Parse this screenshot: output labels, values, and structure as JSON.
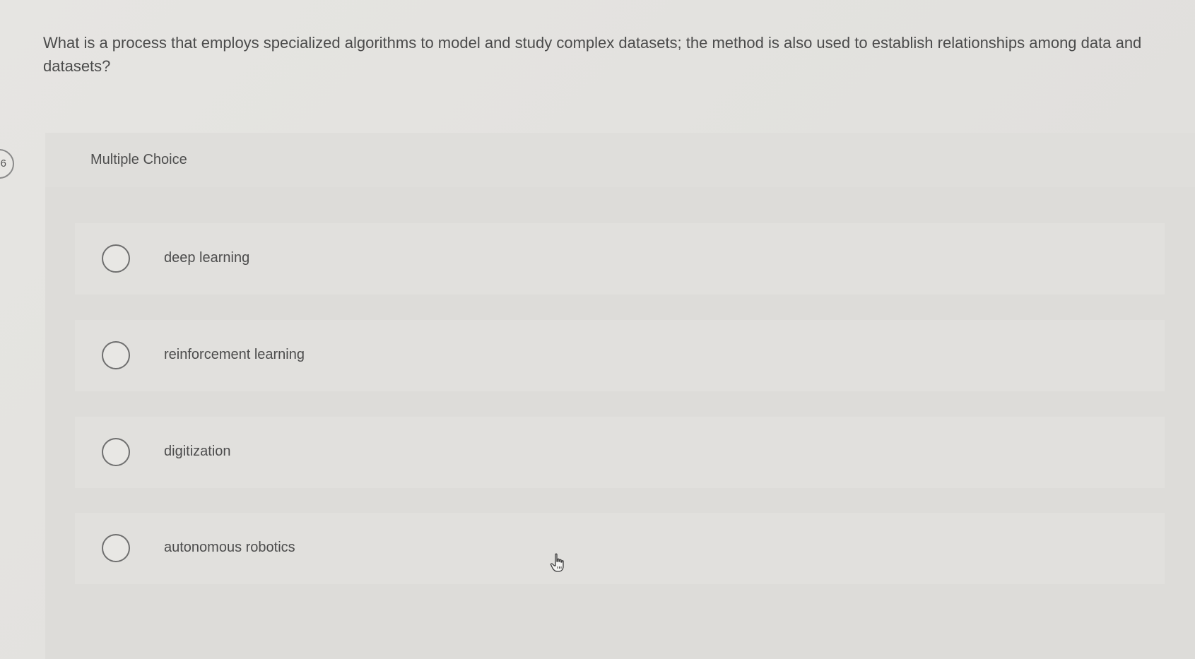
{
  "question": {
    "number": "6",
    "text": "What is a process that employs specialized algorithms to model and study complex datasets; the method is also used to establish relationships among data and datasets?"
  },
  "choice_section": {
    "label": "Multiple Choice",
    "options": [
      {
        "label": "deep learning"
      },
      {
        "label": "reinforcement learning"
      },
      {
        "label": "digitization"
      },
      {
        "label": "autonomous robotics"
      }
    ]
  },
  "colors": {
    "background": "#e3e2df",
    "panel": "#dddcd9",
    "option_row": "#e1e0dd",
    "text": "#4b4b4b",
    "radio_border": "#6f6f6f"
  },
  "icons": {
    "cursor": "hand-pointer-icon",
    "radio": "radio-unselected-icon"
  }
}
